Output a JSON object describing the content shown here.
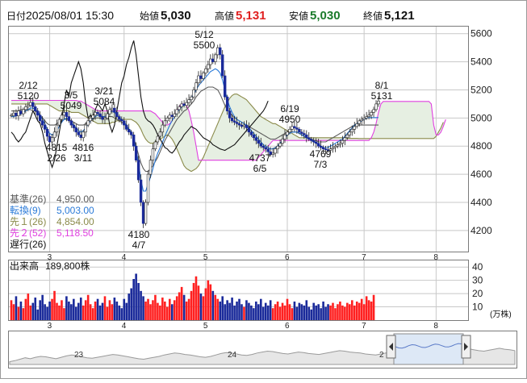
{
  "header": {
    "date_label": "日付",
    "datetime": "2025/08/01 15:30",
    "open_label": "始値",
    "open": "5,030",
    "high_label": "高値",
    "high": "5,131",
    "low_label": "安値",
    "low": "5,030",
    "close_label": "終値",
    "close": "5,121"
  },
  "colors": {
    "up": "#ff2020",
    "down": "#1a2a9a",
    "kijun": "#5a5a5a",
    "tenkan": "#2a7ad8",
    "senkou1": "#8a8a4a",
    "senkou2": "#e040e0",
    "chikou": "#111111",
    "cloud": "#e6efe2",
    "grid": "#c8c8c8"
  },
  "legend": [
    {
      "label": "基準(26)",
      "value": "4,950.00",
      "color": "#5a5a5a"
    },
    {
      "label": "転換(9)",
      "value": "5,003.00",
      "color": "#2a7ad8"
    },
    {
      "label": "先１(26)",
      "value": "4,854.00",
      "color": "#8a8a4a"
    },
    {
      "label": "先２(52)",
      "value": "5,118.50",
      "color": "#e040e0"
    },
    {
      "label": "遅行(26)",
      "value": "",
      "color": "#111111"
    }
  ],
  "volume_header": {
    "label": "出来高",
    "value": "189,800株"
  },
  "volume_unit": "(万株)",
  "navigator": {
    "labels": [
      "23",
      "24",
      "2"
    ]
  },
  "chart_data": {
    "type": "candlestick",
    "x_tick_labels": [
      "3",
      "4",
      "5",
      "6",
      "7",
      "8"
    ],
    "y_ticks": [
      4200,
      4400,
      4600,
      4800,
      5000,
      5200,
      5400,
      5600
    ],
    "ylim": [
      4050,
      5650
    ],
    "volume_ticks": [
      10,
      20,
      30,
      40
    ],
    "volume_ylim": [
      0,
      45
    ],
    "annotations": [
      {
        "text": "2/12",
        "value": "5120"
      },
      {
        "text": "3/5",
        "value": "5049"
      },
      {
        "text": "3/21",
        "value": "5084"
      },
      {
        "text": "5/12",
        "value": "5500"
      },
      {
        "text": "6/19",
        "value": "4950"
      },
      {
        "text": "8/1",
        "value": "5131"
      },
      {
        "text": "4815",
        "value": "2/26"
      },
      {
        "text": "4816",
        "value": "3/11"
      },
      {
        "text": "4180",
        "value": "4/7"
      },
      {
        "text": "4737",
        "value": "6/5"
      },
      {
        "text": "4769",
        "value": "7/3"
      }
    ],
    "close_series": [
      5020,
      5035,
      5015,
      5050,
      5030,
      5060,
      5080,
      5090,
      5110,
      5080,
      5050,
      5020,
      4980,
      4950,
      4920,
      4870,
      4830,
      4860,
      4900,
      4950,
      4990,
      5020,
      5040,
      5010,
      4980,
      4950,
      4930,
      4900,
      4880,
      4860,
      4900,
      4950,
      4980,
      5000,
      5020,
      5040,
      5030,
      5010,
      4990,
      5000,
      5030,
      5060,
      5070,
      5040,
      5010,
      4990,
      4980,
      4950,
      4920,
      4900,
      4880,
      4800,
      4700,
      4560,
      4400,
      4250,
      4400,
      4600,
      4700,
      4780,
      4830,
      4870,
      4900,
      4950,
      4980,
      5000,
      5020,
      5010,
      5030,
      5060,
      5080,
      5100,
      5090,
      5110,
      5130,
      5150,
      5200,
      5250,
      5300,
      5280,
      5320,
      5350,
      5380,
      5420,
      5400,
      5450,
      5500,
      5450,
      5300,
      5150,
      5050,
      5000,
      4980,
      4970,
      4960,
      4950,
      4940,
      4950,
      4930,
      4900,
      4880,
      4860,
      4840,
      4820,
      4800,
      4790,
      4780,
      4760,
      4740,
      4750,
      4780,
      4800,
      4820,
      4850,
      4880,
      4900,
      4920,
      4940,
      4930,
      4920,
      4900,
      4890,
      4880,
      4860,
      4850,
      4840,
      4830,
      4820,
      4800,
      4790,
      4780,
      4775,
      4770,
      4780,
      4790,
      4800,
      4810,
      4820,
      4840,
      4860,
      4880,
      4900,
      4920,
      4940,
      4960,
      4980,
      4990,
      5000,
      5010,
      5020,
      5040,
      5060,
      5100,
      5121
    ],
    "tenkan_series": [
      5010,
      5010,
      5015,
      5020,
      5030,
      5040,
      5050,
      5060,
      5070,
      5070,
      5060,
      5050,
      5020,
      4990,
      4960,
      4920,
      4890,
      4880,
      4890,
      4910,
      4940,
      4970,
      4990,
      5000,
      4990,
      4970,
      4950,
      4930,
      4910,
      4900,
      4910,
      4930,
      4960,
      4980,
      5000,
      5010,
      5020,
      5020,
      5010,
      5010,
      5020,
      5040,
      5050,
      5040,
      5020,
      5000,
      4990,
      4970,
      4950,
      4920,
      4900,
      4850,
      4780,
      4680,
      4560,
      4480,
      4480,
      4530,
      4580,
      4640,
      4700,
      4750,
      4790,
      4830,
      4870,
      4910,
      4950,
      4980,
      5010,
      5040,
      5060,
      5080,
      5090,
      5100,
      5120,
      5140,
      5170,
      5200,
      5230,
      5250,
      5270,
      5290,
      5310,
      5330,
      5340,
      5350,
      5340,
      5320,
      5270,
      5200,
      5130,
      5080,
      5040,
      5010,
      4990,
      4980,
      4970,
      4960,
      4950,
      4930,
      4910,
      4890,
      4870,
      4850,
      4830,
      4810,
      4800,
      4790,
      4780,
      4780,
      4790,
      4800,
      4820,
      4840,
      4860,
      4880,
      4890,
      4900,
      4900,
      4900,
      4890,
      4880,
      4870,
      4860,
      4850,
      4840,
      4830,
      4820,
      4810,
      4800,
      4790,
      4790,
      4790,
      4800,
      4810,
      4820,
      4830,
      4840,
      4850,
      4870,
      4890,
      4910,
      4930,
      4950,
      4960,
      4970,
      4980,
      4990,
      5000,
      5003,
      5003,
      5003,
      5003,
      5003
    ],
    "kijun_series": [
      5050,
      5050,
      5050,
      5050,
      5060,
      5060,
      5060,
      5060,
      5060,
      5050,
      5050,
      5040,
      5020,
      5000,
      4980,
      4960,
      4950,
      4950,
      4950,
      4960,
      4970,
      4980,
      4990,
      4990,
      4990,
      4980,
      4970,
      4960,
      4950,
      4950,
      4950,
      4960,
      4970,
      4980,
      4990,
      5000,
      5000,
      5000,
      5000,
      5000,
      5010,
      5010,
      5010,
      5000,
      4990,
      4980,
      4970,
      4960,
      4940,
      4920,
      4900,
      4860,
      4800,
      4740,
      4680,
      4640,
      4620,
      4620,
      4640,
      4660,
      4690,
      4720,
      4760,
      4800,
      4840,
      4870,
      4900,
      4930,
      4960,
      4990,
      5010,
      5030,
      5050,
      5060,
      5080,
      5100,
      5120,
      5150,
      5170,
      5190,
      5200,
      5210,
      5220,
      5220,
      5220,
      5210,
      5200,
      5170,
      5130,
      5090,
      5060,
      5040,
      5020,
      5000,
      4990,
      4980,
      4970,
      4960,
      4950,
      4940,
      4930,
      4920,
      4910,
      4900,
      4890,
      4880,
      4870,
      4860,
      4850,
      4850,
      4850,
      4860,
      4870,
      4880,
      4890,
      4900,
      4900,
      4900,
      4900,
      4900,
      4890,
      4880,
      4870,
      4860,
      4850,
      4850,
      4840,
      4840,
      4830,
      4830,
      4830,
      4830,
      4840,
      4850,
      4860,
      4870,
      4880,
      4890,
      4900,
      4910,
      4920,
      4930,
      4940,
      4950,
      4950,
      4950,
      4950,
      4950,
      4950,
      4950,
      4950,
      4950,
      4950,
      4950
    ],
    "senkou1_series": [
      5100,
      5100,
      5100,
      5100,
      5100,
      5100,
      5100,
      5100,
      5100,
      5100,
      5100,
      5100,
      5100,
      5100,
      5100,
      5100,
      5090,
      5080,
      5070,
      5060,
      5050,
      5050,
      5050,
      5050,
      5050,
      5040,
      5040,
      5040,
      5040,
      5030,
      5020,
      5010,
      5000,
      4990,
      4980,
      4970,
      4960,
      4960,
      4960,
      4960,
      4960,
      4960,
      4970,
      4970,
      4980,
      4980,
      4990,
      4990,
      4990,
      4990,
      4990,
      4980,
      4970,
      4950,
      4920,
      4880,
      4850,
      4830,
      4820,
      4820,
      4830,
      4840,
      4850,
      4860,
      4870,
      4880,
      4870,
      4850,
      4820,
      4780,
      4740,
      4700,
      4660,
      4640,
      4630,
      4620,
      4630,
      4640,
      4660,
      4690,
      4720,
      4760,
      4800,
      4840,
      4880,
      4920,
      4960,
      5000,
      5040,
      5080,
      5110,
      5140,
      5160,
      5170,
      5170,
      5160,
      5150,
      5140,
      5130,
      5110,
      5090,
      5070,
      5050,
      5030,
      5010,
      5000,
      4990,
      4980,
      4970,
      4960,
      4960,
      4950,
      4940,
      4930,
      4920,
      4910,
      4900,
      4890,
      4880,
      4870,
      4860,
      4860,
      4860,
      4860,
      4860,
      4860,
      4860,
      4860,
      4860,
      4860,
      4860,
      4860,
      4860,
      4860,
      4860,
      4860,
      4860,
      4860,
      4860,
      4860,
      4855,
      4855,
      4855,
      4855,
      4855,
      4854,
      4854,
      4854,
      4854,
      4854,
      4854,
      4854,
      4854,
      4854,
      4854,
      4854,
      4854,
      4854,
      4854,
      4854,
      4854,
      4854,
      4854,
      4854,
      4854,
      4854,
      4854,
      4854,
      4854,
      4854,
      4854,
      4854,
      4854,
      4854,
      4854,
      4854,
      4854,
      4870,
      4900,
      4930,
      4970
    ],
    "senkou2_series": [
      5125,
      5125,
      5125,
      5125,
      5125,
      5125,
      5125,
      5125,
      5125,
      5125,
      5125,
      5125,
      5125,
      5125,
      5125,
      5125,
      5125,
      5125,
      5125,
      5125,
      5125,
      5125,
      5125,
      5125,
      5125,
      5125,
      5125,
      5125,
      5120,
      5120,
      5110,
      5100,
      5090,
      5080,
      5070,
      5060,
      5050,
      5050,
      5050,
      5050,
      5050,
      5050,
      5050,
      5050,
      5050,
      5050,
      5050,
      5050,
      5050,
      5050,
      5050,
      5050,
      5050,
      5050,
      5050,
      5050,
      5050,
      5050,
      5050,
      5040,
      5030,
      5010,
      4990,
      4970,
      4950,
      4950,
      4960,
      4980,
      5010,
      5050,
      5080,
      5100,
      5100,
      5090,
      5050,
      4980,
      4900,
      4800,
      4700,
      4700,
      4700,
      4700,
      4700,
      4700,
      4700,
      4700,
      4700,
      4700,
      4700,
      4700,
      4700,
      4700,
      4700,
      4700,
      4700,
      4700,
      4700,
      4700,
      4700,
      4700,
      4700,
      4700,
      4700,
      4720,
      4740,
      4760,
      4780,
      4800,
      4820,
      4840,
      4840,
      4840,
      4840,
      4840,
      4840,
      4840,
      4840,
      4840,
      4840,
      4840,
      4840,
      4840,
      4840,
      4840,
      4840,
      4840,
      4840,
      4840,
      4840,
      4840,
      4840,
      4840,
      4840,
      4840,
      4840,
      4840,
      4840,
      4840,
      4840,
      4840,
      4840,
      4840,
      4840,
      4840,
      4840,
      4840,
      4840,
      4840,
      4840,
      4840,
      4860,
      4900,
      4960,
      5040,
      5100,
      5118,
      5118,
      5118,
      5118,
      5118,
      5118,
      5118,
      5118,
      5118,
      5118,
      5118,
      5118,
      5118,
      5118,
      5118,
      5118,
      5118,
      5118,
      5118,
      5118,
      5100,
      4950,
      4880,
      4880,
      4900,
      4940,
      4990
    ],
    "chikou_series": [
      4900,
      4880,
      4850,
      4830,
      4850,
      4880,
      4900,
      4950,
      5000,
      5050,
      5020,
      4980,
      4960,
      4900,
      4820,
      4760,
      4700,
      4650,
      4700,
      4800,
      4900,
      5000,
      5100,
      5200,
      5150,
      5250,
      5300,
      5350,
      5400,
      5350,
      5250,
      5100,
      5000,
      5020,
      5000,
      5060,
      5100,
      5080,
      5050,
      5100,
      5050,
      4950,
      4900,
      4950,
      5050,
      5150,
      5250,
      5300,
      5380,
      5430,
      5500,
      5550,
      5450,
      5300,
      5150,
      5050,
      5000,
      4980,
      4970,
      4950,
      4920,
      4880,
      4850,
      4820,
      4790,
      4780,
      4760,
      4750,
      4770,
      4800,
      4830,
      4850,
      4880,
      4900,
      4920,
      4940,
      4930,
      4920,
      4900,
      4880,
      4860,
      4850,
      4840,
      4830,
      4810,
      4800,
      4790,
      4780,
      4775,
      4770,
      4780,
      4790,
      4800,
      4810,
      4830,
      4850,
      4870,
      4890,
      4910,
      4930,
      4950,
      4970,
      4990,
      5010,
      5030,
      5050,
      5080,
      5121
    ],
    "volume": [
      15,
      12,
      18,
      10,
      14,
      9,
      16,
      20,
      11,
      13,
      17,
      8,
      15,
      19,
      12,
      10,
      14,
      16,
      22,
      13,
      11,
      15,
      9,
      18,
      14,
      12,
      16,
      10,
      13,
      17,
      11,
      15,
      19,
      12,
      9,
      14,
      16,
      11,
      13,
      18,
      10,
      15,
      12,
      17,
      14,
      11,
      9,
      16,
      13,
      20,
      24,
      31,
      35,
      28,
      22,
      18,
      14,
      16,
      12,
      15,
      19,
      13,
      11,
      17,
      14,
      10,
      16,
      12,
      15,
      18,
      21,
      25,
      19,
      14,
      16,
      22,
      28,
      33,
      26,
      20,
      18,
      24,
      30,
      27,
      22,
      19,
      16,
      14,
      18,
      12,
      15,
      13,
      17,
      11,
      14,
      16,
      12,
      10,
      15,
      13,
      11,
      9,
      14,
      12,
      16,
      10,
      13,
      11,
      15,
      9,
      12,
      14,
      10,
      13,
      11,
      16,
      12,
      9,
      14,
      10,
      13,
      12,
      11,
      15,
      10,
      8,
      13,
      11,
      12,
      9,
      14,
      10,
      12,
      11,
      13,
      9,
      12,
      14,
      11,
      10,
      13,
      12,
      15,
      11,
      14,
      13,
      16,
      12,
      18,
      15,
      14,
      19
    ],
    "navigator_series": [
      4900,
      4920,
      4950,
      4980,
      4960,
      4990,
      5010,
      5000,
      4980,
      4960,
      4990,
      5020,
      5040,
      5030,
      5000,
      4980,
      4970,
      4990,
      5010,
      5030,
      5050,
      5040,
      5020,
      5000,
      4980,
      4960,
      4950,
      4970,
      4990,
      5010,
      5040,
      5060,
      5080,
      5070,
      5050,
      5040,
      5020,
      5000,
      4990,
      5010,
      5040,
      5070,
      5090,
      5080,
      5060,
      5040,
      5030,
      5050,
      5080,
      5100,
      5120,
      5110,
      5090,
      5070,
      5060,
      5080,
      5100,
      5090,
      5070,
      5060,
      5050,
      5070,
      5090,
      5110,
      5130,
      5120,
      5100,
      5090,
      5080,
      5060,
      5050,
      5040,
      5060,
      5080,
      5100,
      5120,
      5140,
      5160,
      5150,
      5130,
      5110,
      5100,
      5120,
      5150,
      5170,
      5200,
      5220,
      5210,
      5190,
      5170,
      5150,
      5130,
      5120,
      5140,
      5160,
      5180,
      5160,
      5150,
      5130
    ]
  }
}
